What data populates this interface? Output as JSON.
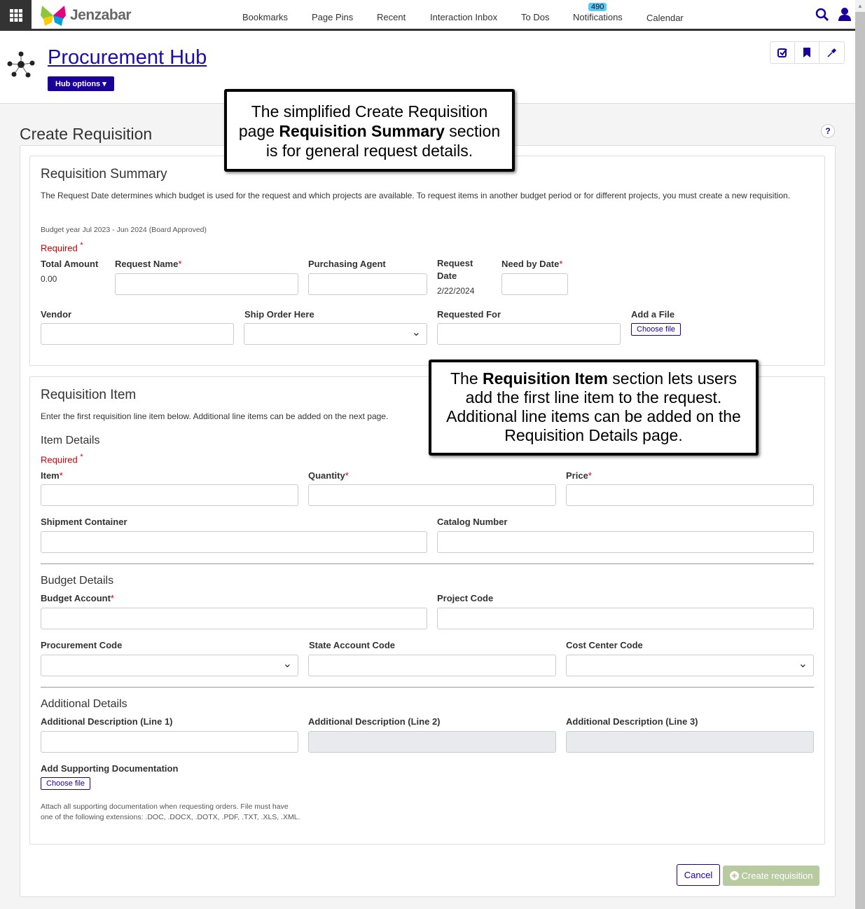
{
  "nav": {
    "brand": "Jenzabar",
    "items": [
      "Bookmarks",
      "Page Pins",
      "Recent",
      "Interaction Inbox",
      "To Dos",
      "Notifications",
      "Calendar"
    ],
    "notifications_count": "490"
  },
  "header": {
    "title": "Procurement Hub",
    "hub_options": "Hub options"
  },
  "page": {
    "title": "Create Requisition",
    "help": "?"
  },
  "summary": {
    "title": "Requisition Summary",
    "description": "The Request Date determines which budget is used for the request and which projects are available. To request items in another budget period or for different projects, you must create a new requisition.",
    "budget_year": "Budget year Jul 2023 - Jun 2024 (Board Approved)",
    "required": "Required",
    "total_amount_label": "Total Amount",
    "total_amount": "0.00",
    "request_name": "Request Name",
    "purchasing_agent": "Purchasing Agent",
    "request_date_label": "Request Date",
    "request_date": "2/22/2024",
    "need_by_date": "Need by Date",
    "vendor": "Vendor",
    "ship_order_here": "Ship Order Here",
    "requested_for": "Requested For",
    "add_file": "Add a File",
    "choose_file": "Choose file"
  },
  "item": {
    "title": "Requisition Item",
    "description": "Enter the first requisition line item below. Additional line items can be added on the next page.",
    "item_details": "Item Details",
    "required": "Required",
    "item": "Item",
    "quantity": "Quantity",
    "price": "Price",
    "shipment_container": "Shipment Container",
    "catalog_number": "Catalog Number",
    "budget_details": "Budget Details",
    "budget_account": "Budget Account",
    "project_code": "Project Code",
    "procurement_code": "Procurement Code",
    "state_account_code": "State Account Code",
    "cost_center_code": "Cost Center Code",
    "additional_details": "Additional Details",
    "desc1": "Additional Description (Line 1)",
    "desc2": "Additional Description (Line 2)",
    "desc3": "Additional Description (Line 3)",
    "supporting_docs": "Add Supporting Documentation",
    "choose_file": "Choose file",
    "attach_note": "Attach all supporting documentation when requesting orders. File must have one of the following extensions: .DOC, .DOCX, .DOTX, .PDF, .TXT, .XLS, .XML."
  },
  "actions": {
    "cancel": "Cancel",
    "create": "Create requisition"
  },
  "callouts": {
    "c1_a": "The simplified Create Requisition page ",
    "c1_b": "Requisition Summary",
    "c1_c": " section is for general request details.",
    "c2_a": "The ",
    "c2_b": "Requisition Item",
    "c2_c": " section lets users add the first line item to the request. Additional line items can be added on the Requisition Details page."
  },
  "colors": {
    "brand": "#1a0099",
    "required": "#cc0000",
    "badge": "#5bc8f5"
  }
}
